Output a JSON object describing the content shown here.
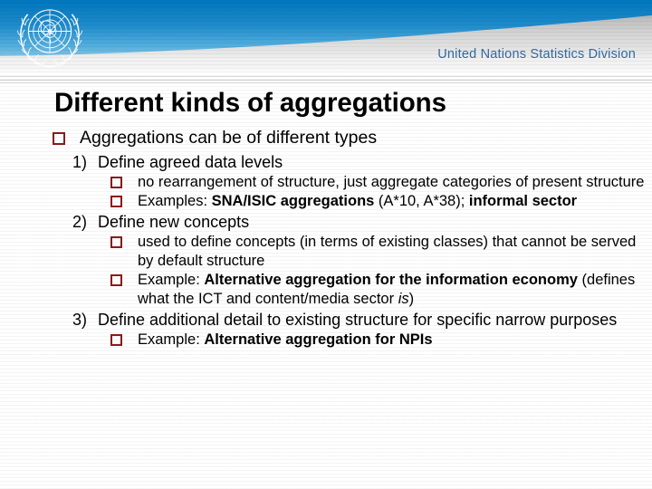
{
  "header": {
    "emblem_name": "un-emblem-icon",
    "division": "United Nations Statistics Division",
    "colors": {
      "banner_blue_top": "#0076bd",
      "banner_blue_bottom": "#c8e6f4",
      "division_text": "#2f6ba5",
      "bullet_square": "#8a1b1b"
    }
  },
  "title": "Different kinds of aggregations",
  "content": {
    "bullet1": "Aggregations can be of different types",
    "items": [
      {
        "number": "1)",
        "text": "Define agreed data levels",
        "subs": [
          {
            "parts": [
              {
                "text": "no rearrangement of structure, just aggregate categories of present structure",
                "style": "normal"
              }
            ]
          },
          {
            "parts": [
              {
                "text": "Examples: ",
                "style": "normal"
              },
              {
                "text": "SNA/ISIC aggregations",
                "style": "bold"
              },
              {
                "text": " (A*10, A*38); ",
                "style": "normal"
              },
              {
                "text": "informal sector",
                "style": "bold"
              }
            ]
          }
        ]
      },
      {
        "number": "2)",
        "text": "Define new concepts",
        "subs": [
          {
            "parts": [
              {
                "text": "used to define concepts (in terms of existing classes) that cannot be served by default structure",
                "style": "normal"
              }
            ]
          },
          {
            "parts": [
              {
                "text": "Example: ",
                "style": "normal"
              },
              {
                "text": "Alternative aggregation for the information economy",
                "style": "bold"
              },
              {
                "text": " (defines what the ICT and content/media sector ",
                "style": "normal"
              },
              {
                "text": "is",
                "style": "italic"
              },
              {
                "text": ")",
                "style": "normal"
              }
            ]
          }
        ]
      },
      {
        "number": "3)",
        "text": "Define additional detail to existing structure for specific narrow purposes",
        "subs": [
          {
            "parts": [
              {
                "text": "Example: ",
                "style": "normal"
              },
              {
                "text": "Alternative aggregation for NPIs",
                "style": "bold"
              }
            ]
          }
        ]
      }
    ]
  }
}
